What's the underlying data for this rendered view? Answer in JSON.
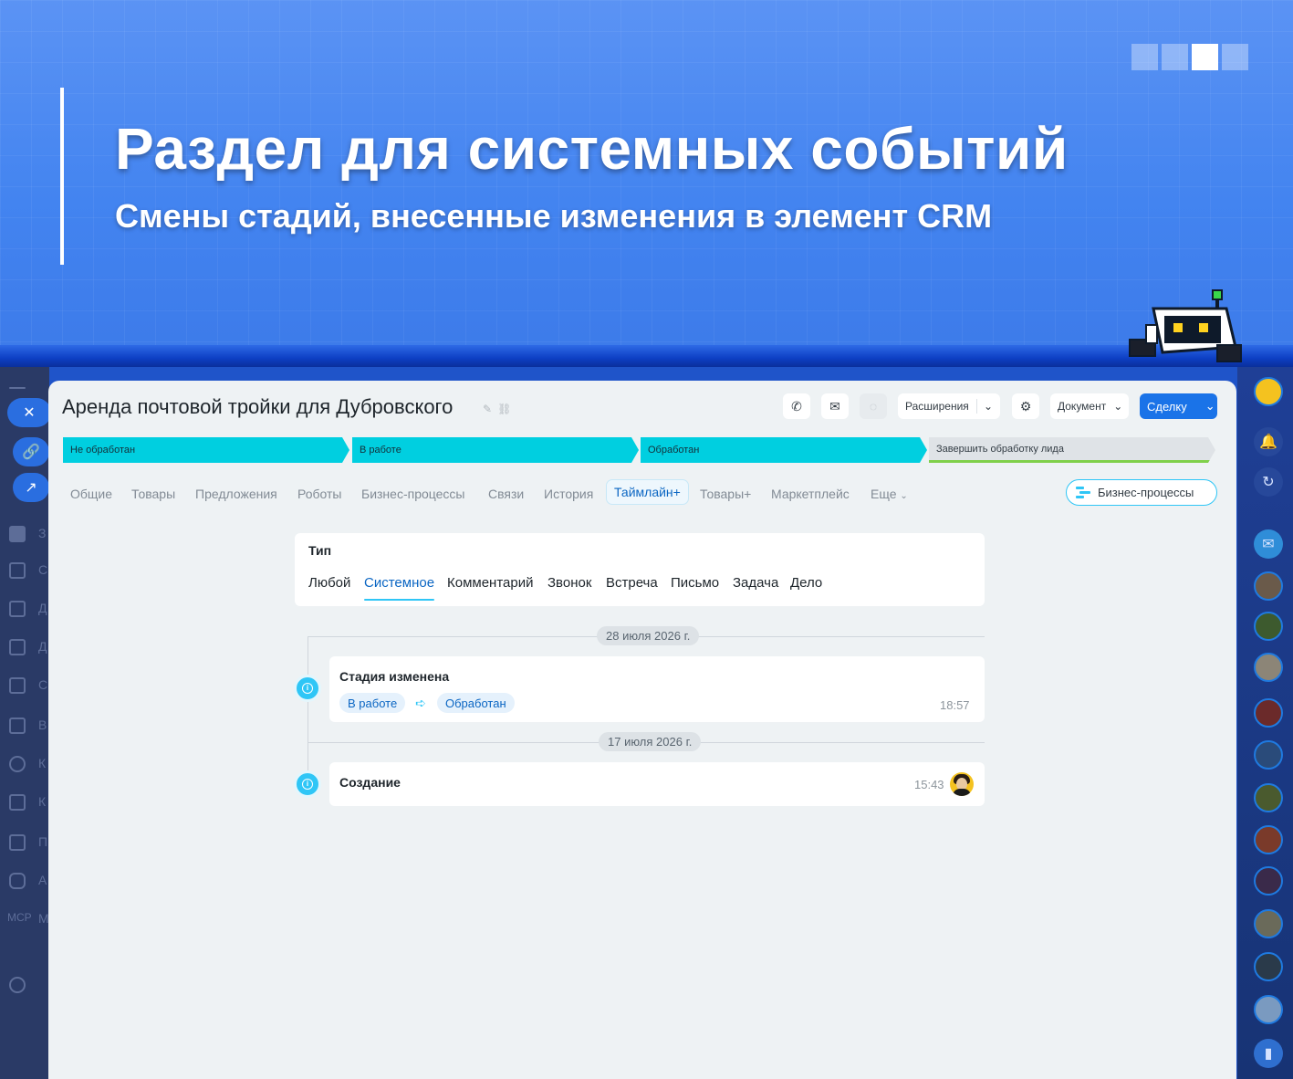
{
  "banner": {
    "title": "Раздел для системных событий",
    "subtitle": "Смены стадий, внесенные изменения в элемент CRM"
  },
  "deal": {
    "title": "Аренда почтовой тройки для Дубровского"
  },
  "toolbar": {
    "extensions_label": "Расширения",
    "document_label": "Документ",
    "create_label": "Сделку"
  },
  "stages": [
    {
      "label": "Не обработан"
    },
    {
      "label": "В работе"
    },
    {
      "label": "Обработан"
    },
    {
      "label": "Завершить обработку лида"
    }
  ],
  "tabs": [
    {
      "label": "Общие"
    },
    {
      "label": "Товары"
    },
    {
      "label": "Предложения"
    },
    {
      "label": "Роботы"
    },
    {
      "label": "Бизнес-процессы"
    },
    {
      "label": "Связи"
    },
    {
      "label": "История"
    },
    {
      "label": "Таймлайн+"
    },
    {
      "label": "Товары+"
    },
    {
      "label": "Маркетплейс"
    },
    {
      "label": "Еще"
    }
  ],
  "bp_button_label": "Бизнес-процессы",
  "filter": {
    "label": "Тип",
    "options": [
      {
        "label": "Любой"
      },
      {
        "label": "Системное"
      },
      {
        "label": "Комментарий"
      },
      {
        "label": "Звонок"
      },
      {
        "label": "Встреча"
      },
      {
        "label": "Письмо"
      },
      {
        "label": "Задача"
      },
      {
        "label": "Дело"
      }
    ],
    "selected": "Системное"
  },
  "timeline": [
    {
      "date": "28 июля 2026 г.",
      "title": "Стадия изменена",
      "from_stage": "В работе",
      "to_stage": "Обработан",
      "time": "18:57"
    },
    {
      "date": "17 июля 2026 г.",
      "title": "Создание",
      "time": "15:43"
    }
  ],
  "colors": {
    "stage_active": "#00cfe0",
    "accent_blue": "#1a73e8",
    "timeline_dot": "#2fc6f6"
  }
}
